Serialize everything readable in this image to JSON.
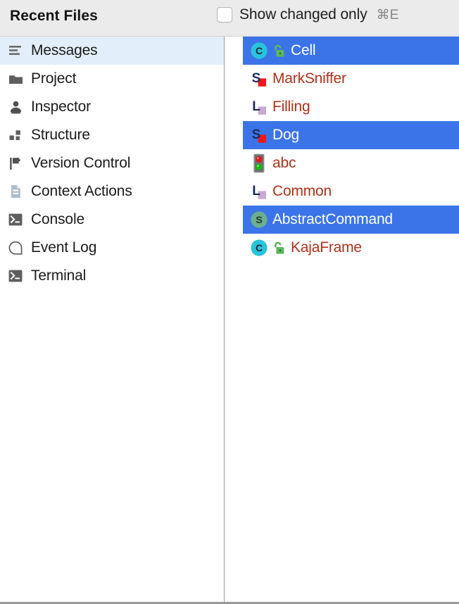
{
  "header": {
    "title": "Recent Files",
    "checkbox": {
      "name": "show-changed-only",
      "label": "Show changed only",
      "checked": false
    },
    "shortcut": "⌘E"
  },
  "colors": {
    "header_bg": "#EBEBEB",
    "selection_blue": "#3B74E8",
    "sidebar_selection": "#E2EFFA",
    "file_text_red": "#B0311B",
    "selected_text": "#FFFFFF",
    "divider": "#9C9C9C",
    "class_icon_cyan": "#29C3DC",
    "class_icon_green": "#6BAF8D",
    "lock_green": "#5CB85C",
    "mark_square_red": "#F21616",
    "mark_letter_navy": "#1B2A5E",
    "fill_square_lavender": "#C9A8D4"
  },
  "sidebar": {
    "items": [
      {
        "label": "Messages",
        "icon": "messages-icon",
        "selected": true
      },
      {
        "label": "Project",
        "icon": "folder-icon",
        "selected": false
      },
      {
        "label": "Inspector",
        "icon": "inspector-icon",
        "selected": false
      },
      {
        "label": "Structure",
        "icon": "structure-icon",
        "selected": false
      },
      {
        "label": "Version Control",
        "icon": "version-control-icon",
        "selected": false
      },
      {
        "label": "Context Actions",
        "icon": "context-actions-icon",
        "selected": false
      },
      {
        "label": "Console",
        "icon": "console-icon",
        "selected": false
      },
      {
        "label": "Event Log",
        "icon": "event-log-icon",
        "selected": false
      },
      {
        "label": "Terminal",
        "icon": "terminal-icon",
        "selected": false
      }
    ]
  },
  "files": {
    "items": [
      {
        "label": "Cell",
        "icon": "class-circle-c-icon",
        "badge": "unlock-icon",
        "selected": true
      },
      {
        "label": "MarkSniffer",
        "icon": "mark-s-red-icon",
        "badge": null,
        "selected": false
      },
      {
        "label": "Filling",
        "icon": "fill-l-lavender-icon",
        "badge": null,
        "selected": false
      },
      {
        "label": "Dog",
        "icon": "mark-s-red-icon",
        "badge": null,
        "selected": true
      },
      {
        "label": "abc",
        "icon": "traffic-light-icon",
        "badge": null,
        "selected": false
      },
      {
        "label": "Common",
        "icon": "fill-l-lavender-icon",
        "badge": null,
        "selected": false
      },
      {
        "label": "AbstractCommand",
        "icon": "class-circle-s-icon",
        "badge": null,
        "selected": true
      },
      {
        "label": "KajaFrame",
        "icon": "class-circle-c-icon",
        "badge": "unlock-icon",
        "selected": false
      }
    ]
  }
}
